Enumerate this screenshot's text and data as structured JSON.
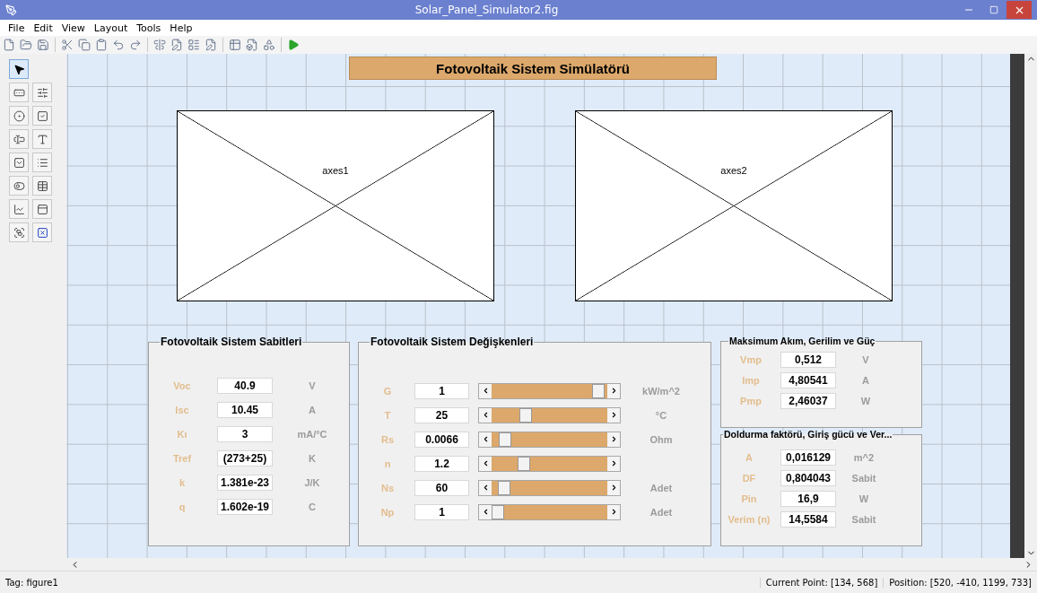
{
  "window": {
    "title": "Solar_Panel_Simulator2.fig"
  },
  "menu": [
    "File",
    "Edit",
    "View",
    "Layout",
    "Tools",
    "Help"
  ],
  "palette": {
    "pointer_selected": true
  },
  "canvas": {
    "title": "Fotovoltaik Sistem Simülatörü",
    "axes": [
      {
        "label": "axes1"
      },
      {
        "label": "axes2"
      }
    ],
    "constants": {
      "title": "Fotovoltaik Sistem Sabitleri",
      "rows": [
        {
          "label": "Voc",
          "value": "40.9",
          "unit": "V"
        },
        {
          "label": "Isc",
          "value": "10.45",
          "unit": "A"
        },
        {
          "label": "Kı",
          "value": "3",
          "unit": "mA/°C"
        },
        {
          "label": "Tref",
          "value": "(273+25)",
          "unit": "K"
        },
        {
          "label": "k",
          "value": "1.381e-23",
          "unit": "J/K"
        },
        {
          "label": "q",
          "value": "1.602e-19",
          "unit": "C"
        }
      ]
    },
    "variables": {
      "title": "Fotovoltaik Sistem Değişkenleri",
      "rows": [
        {
          "label": "G",
          "value": "1",
          "level": 0.97,
          "unit": "kW/m^2"
        },
        {
          "label": "T",
          "value": "25",
          "level": 0.27,
          "unit": "°C"
        },
        {
          "label": "Rs",
          "value": "0.0066",
          "level": 0.07,
          "unit": "Ohm"
        },
        {
          "label": "n",
          "value": "1.2",
          "level": 0.25
        },
        {
          "label": "Ns",
          "value": "60",
          "level": 0.06,
          "unit": "Adet"
        },
        {
          "label": "Np",
          "value": "1",
          "level": 0.0,
          "unit": "Adet"
        }
      ]
    },
    "maximum": {
      "title": "Maksimum Akım, Gerilim ve Güç",
      "rows": [
        {
          "label": "Vmp",
          "value": "0,512",
          "unit": "V"
        },
        {
          "label": "Imp",
          "value": "4,80541",
          "unit": "A"
        },
        {
          "label": "Pmp",
          "value": "2,46037",
          "unit": "W"
        }
      ]
    },
    "fill_factor": {
      "title": "Doldurma faktörü, Giriş gücü ve Ver...",
      "rows": [
        {
          "label": "A",
          "value": "0,016129",
          "unit": "m^2"
        },
        {
          "label": "DF",
          "value": "0,804043",
          "unit": "Sabit"
        },
        {
          "label": "Pin",
          "value": "16,9",
          "unit": "W"
        },
        {
          "label": "Verim (n)",
          "value": "14,5584",
          "unit": "Sabit"
        }
      ]
    }
  },
  "status_bar": {
    "tag": "Tag: figure1",
    "current_point": "Current Point:  [134, 568]",
    "position": "Position: [520, -410, 1199, 733]"
  }
}
